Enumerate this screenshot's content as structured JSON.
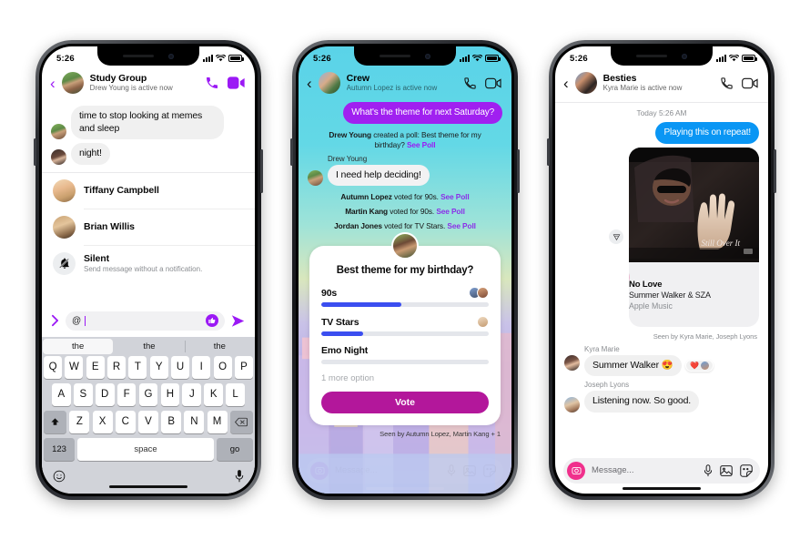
{
  "phones": [
    {
      "id": "study-group",
      "status": {
        "time": "5:26",
        "signal": "signal-bars",
        "wifi": "wifi-icon",
        "battery": "battery-icon"
      },
      "header": {
        "back": "‹",
        "title": "Study Group",
        "subtitle": "Drew Young is active now",
        "call_icon": "phone-icon",
        "video_icon": "video-camera-icon"
      },
      "messages": [
        {
          "text": "time to stop looking at memes and sleep"
        },
        {
          "text": "night!"
        }
      ],
      "mentions": [
        {
          "name": "Tiffany Campbell"
        },
        {
          "name": "Brian Willis"
        }
      ],
      "silent": {
        "title": "Silent",
        "subtitle": "Send message without a notification.",
        "icon": "bell-slash-icon"
      },
      "composer": {
        "expand_icon": "chevron-right-icon",
        "value": "@",
        "like_icon": "thumbs-up-icon",
        "send_icon": "send-arrow-icon"
      },
      "keyboard": {
        "suggestions": [
          "the",
          "the",
          "the"
        ],
        "row1": [
          "Q",
          "W",
          "E",
          "R",
          "T",
          "Y",
          "U",
          "I",
          "O",
          "P"
        ],
        "row2": [
          "A",
          "S",
          "D",
          "F",
          "G",
          "H",
          "J",
          "K",
          "L"
        ],
        "row3": [
          "Z",
          "X",
          "C",
          "V",
          "B",
          "N",
          "M"
        ],
        "shift": "shift-key",
        "backspace": "backspace-key",
        "numbers": "123",
        "space": "space",
        "enter": "go",
        "emoji_icon": "emoji-key",
        "mic_icon": "dictation-key"
      }
    },
    {
      "id": "crew",
      "status": {
        "time": "5:26"
      },
      "header": {
        "back": "‹",
        "title": "Crew",
        "subtitle": "Autumn Lopez is active now",
        "call_icon": "phone-icon",
        "video_icon": "video-camera-icon"
      },
      "sent_bubble": "What's the theme for next Saturday?",
      "poll_created": {
        "author": "Drew Young",
        "text": " created a poll: Best theme for my birthday? ",
        "link": "See Poll"
      },
      "sender_label": "Drew Young",
      "reply_bubble": "I need help deciding!",
      "votes": [
        {
          "name": "Autumn Lopez",
          "text": " voted for 90s. ",
          "link": "See Poll"
        },
        {
          "name": "Martin Kang",
          "text": " voted for 90s. ",
          "link": "See Poll"
        },
        {
          "name": "Jordan Jones",
          "text": " voted for TV Stars. ",
          "link": "See Poll"
        }
      ],
      "poll": {
        "question": "Best theme for my birthday?",
        "options": [
          {
            "label": "90s",
            "percent": 48,
            "voters": 2
          },
          {
            "label": "TV Stars",
            "percent": 25,
            "voters": 1
          },
          {
            "label": "Emo Night",
            "percent": 0,
            "voters": 0
          }
        ],
        "more": "1 more option",
        "vote_label": "Vote",
        "bar_color": "#3b4ef0",
        "button_color": "#b3179b"
      },
      "seen": "Seen by Autumn Lopez, Martin Kang + 1",
      "composer": {
        "camera_icon": "camera-icon",
        "placeholder": "Message...",
        "mic_icon": "microphone-icon",
        "gallery_icon": "photo-icon",
        "sticker_icon": "sticker-icon"
      }
    },
    {
      "id": "besties",
      "status": {
        "time": "5:26"
      },
      "header": {
        "back": "‹",
        "title": "Besties",
        "subtitle": "Kyra Marie is active now",
        "call_icon": "phone-icon",
        "video_icon": "video-camera-icon"
      },
      "daystamp": "Today 5:26 AM",
      "sent_bubble": "Playing this on repeat!",
      "badge_icon": "share-triangle-icon",
      "music": {
        "title": "No Love",
        "artist": "Summer Walker & SZA",
        "source": "Apple Music",
        "play_icon": "play-icon",
        "art_caption": "Still Over It"
      },
      "seen": "Seen by Kyra Marie, Joseph Lyons",
      "replies": [
        {
          "sender": "Kyra Marie",
          "text": "Summer Walker 😍",
          "reaction": "❤️"
        },
        {
          "sender": "Joseph Lyons",
          "text": "Listening now. So good."
        }
      ],
      "composer": {
        "camera_icon": "camera-icon",
        "placeholder": "Message...",
        "mic_icon": "microphone-icon",
        "gallery_icon": "photo-icon",
        "sticker_icon": "sticker-icon"
      }
    }
  ],
  "colors": {
    "purple": "#9b19f5",
    "blue": "#0a96f4",
    "magenta": "#b3179b",
    "pink": "#f0308c"
  }
}
